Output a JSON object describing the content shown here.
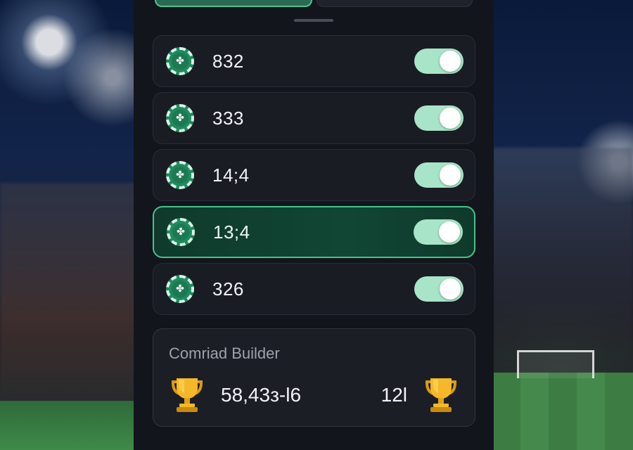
{
  "rows": [
    {
      "value": "832",
      "toggle_on": true
    },
    {
      "value": "333",
      "toggle_on": true
    },
    {
      "value": "14;4",
      "toggle_on": true
    },
    {
      "value": "13;4",
      "toggle_on": true
    },
    {
      "value": "326",
      "toggle_on": true
    }
  ],
  "chip_icon": "clover-chip-icon",
  "builder": {
    "title": "Comriad Builder",
    "score": "58,43з-l6",
    "count": "12l"
  },
  "colors": {
    "accent": "#46c28c",
    "toggle_track": "#a8e5c8",
    "panel_bg": "#13151c"
  }
}
